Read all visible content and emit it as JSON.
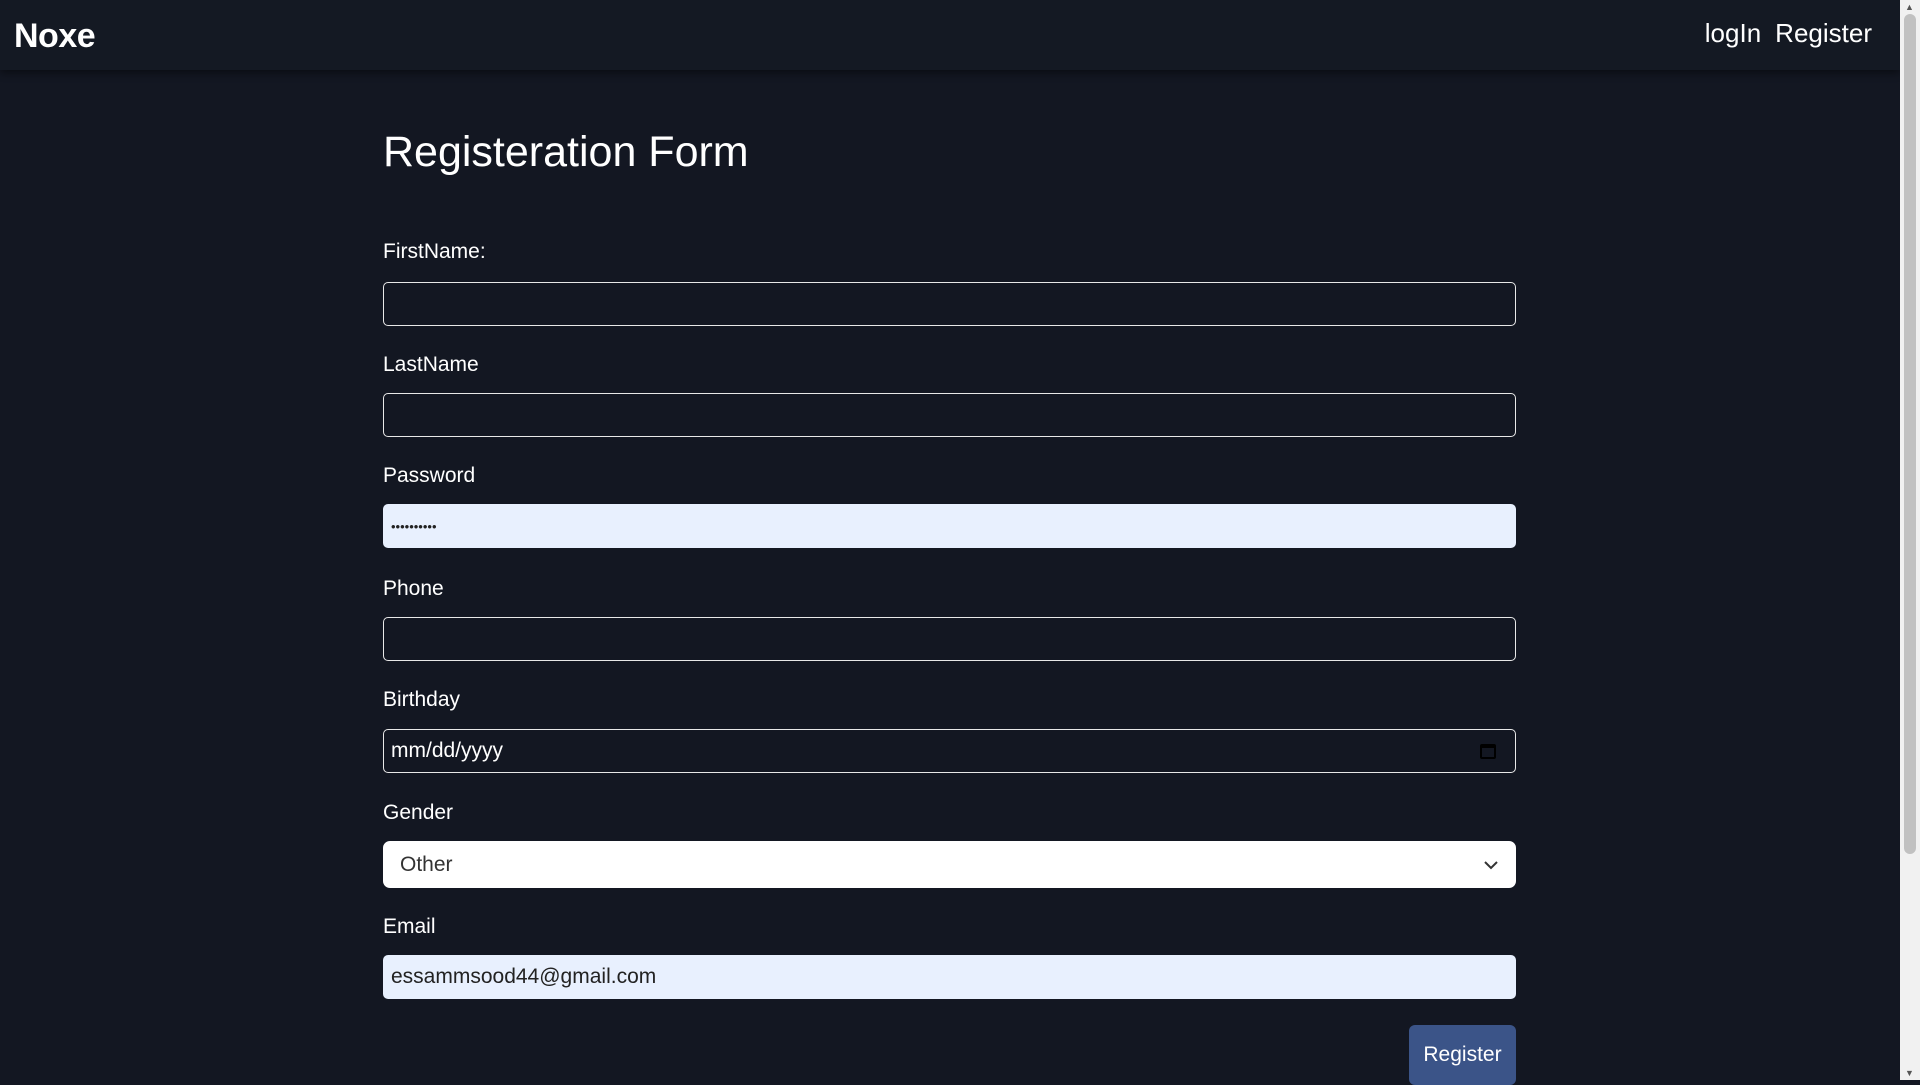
{
  "nav": {
    "logo": "Noxe",
    "login": "logIn",
    "register": "Register"
  },
  "form": {
    "title": "Registeration Form",
    "firstname_label": "FirstName:",
    "firstname_value": "",
    "lastname_label": "LastName",
    "lastname_value": "",
    "password_label": "Password",
    "password_value": "••••••••••",
    "phone_label": "Phone",
    "phone_value": "",
    "birthday_label": "Birthday",
    "birthday_placeholder": "mm/dd/yyyy",
    "gender_label": "Gender",
    "gender_value": "Other",
    "email_label": "Email",
    "email_value": "essammsood44@gmail.com",
    "submit": "Register"
  }
}
